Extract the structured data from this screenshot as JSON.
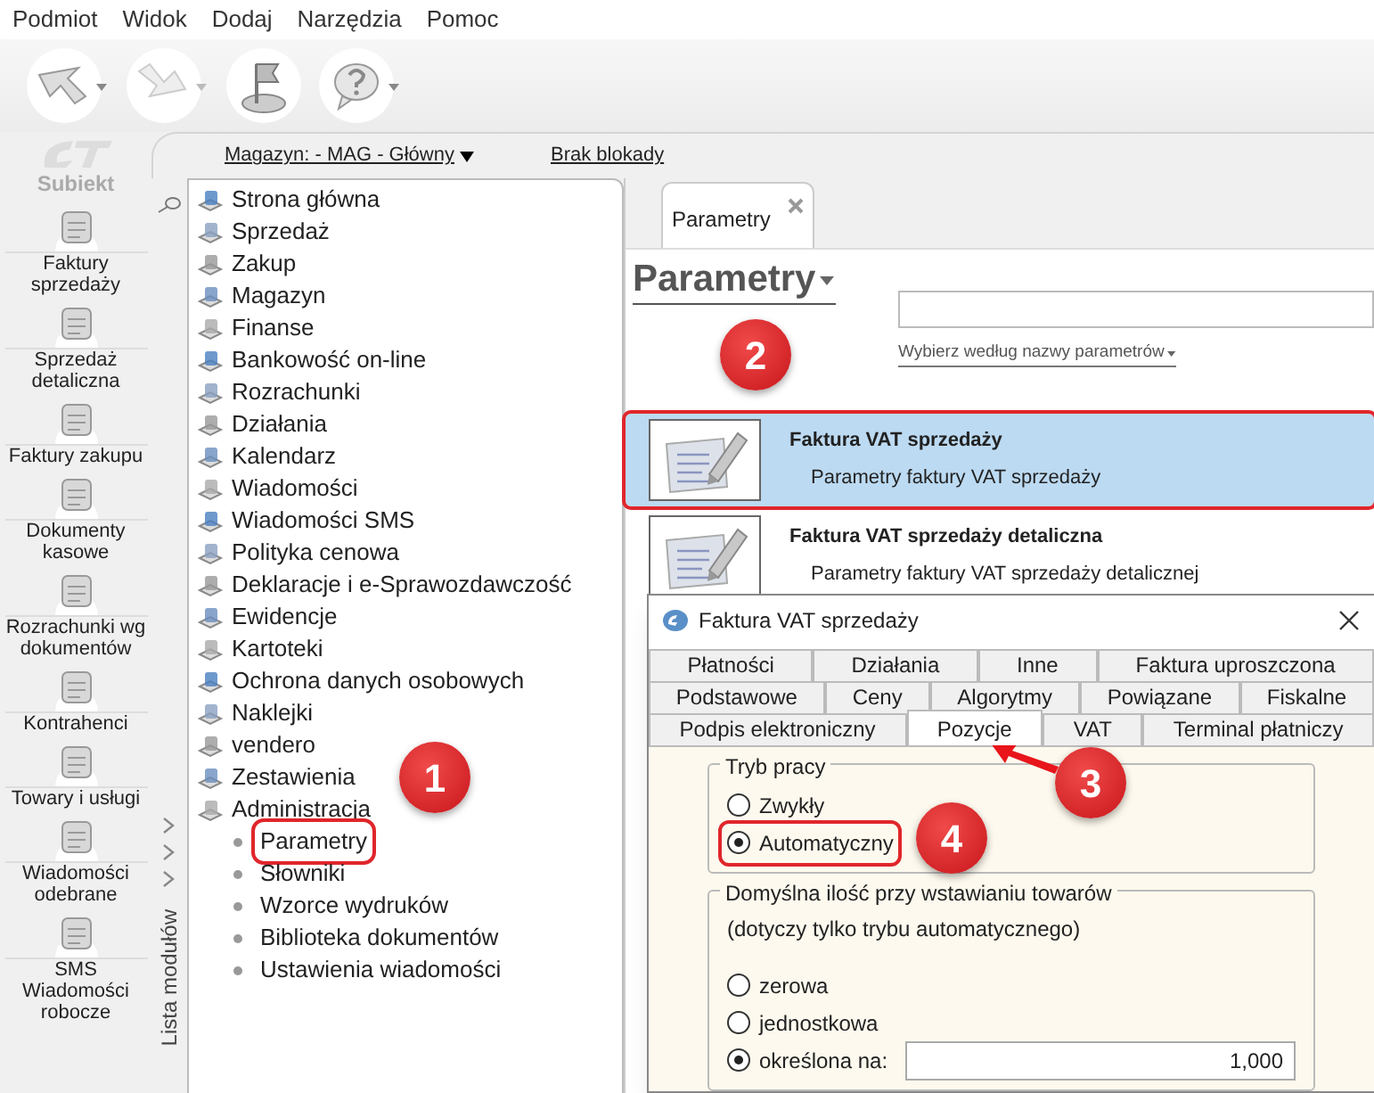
{
  "menu": [
    "Podmiot",
    "Widok",
    "Dodaj",
    "Narzędzia",
    "Pomoc"
  ],
  "sidebar": {
    "logo_text": "Subiekt",
    "items": [
      "Faktury sprzedaży",
      "Sprzedaż detaliczna",
      "Faktury zakupu",
      "Dokumenty kasowe",
      "Rozrachunki wg dokumentów",
      "Kontrahenci",
      "Towary i usługi",
      "Wiadomości odebrane",
      "SMS Wiadomości robocze"
    ]
  },
  "header": {
    "warehouse": "Magazyn: - MAG - Główny",
    "lock": "Brak blokady"
  },
  "modules": {
    "strip_label": "Lista modułów",
    "tree": [
      {
        "label": "Strona główna"
      },
      {
        "label": "Sprzedaż"
      },
      {
        "label": "Zakup"
      },
      {
        "label": "Magazyn"
      },
      {
        "label": "Finanse"
      },
      {
        "label": "Bankowość on-line"
      },
      {
        "label": "Rozrachunki"
      },
      {
        "label": "Działania"
      },
      {
        "label": "Kalendarz"
      },
      {
        "label": "Wiadomości"
      },
      {
        "label": "Wiadomości SMS"
      },
      {
        "label": "Polityka cenowa"
      },
      {
        "label": "Deklaracje i e-Sprawozdawczość"
      },
      {
        "label": "Ewidencje"
      },
      {
        "label": "Kartoteki"
      },
      {
        "label": "Ochrona danych osobowych"
      },
      {
        "label": "Naklejki"
      },
      {
        "label": "vendero"
      },
      {
        "label": "Zestawienia"
      },
      {
        "label": "Administracja",
        "children": [
          {
            "label": "Parametry",
            "highlighted": true
          },
          {
            "label": "Słowniki",
            "highlighted": false
          },
          {
            "label": "Wzorce wydruków",
            "highlighted": false
          },
          {
            "label": "Biblioteka dokumentów",
            "highlighted": false
          },
          {
            "label": "Ustawienia wiadomości",
            "highlighted": false
          }
        ]
      }
    ]
  },
  "doc_tabs": [
    {
      "label": "Parametry",
      "selected": true
    }
  ],
  "page_title": "Parametry",
  "filter_link": "Wybierz według nazwy parametrów",
  "results": [
    {
      "title": "Faktura VAT sprzedaży",
      "description": "Parametry faktury VAT sprzedaży",
      "selected": true,
      "highlighted": true
    },
    {
      "title": "Faktura VAT sprzedaży detaliczna",
      "description": "Parametry faktury VAT sprzedaży detalicznej",
      "selected": false,
      "highlighted": false
    }
  ],
  "dialog": {
    "title": "Faktura VAT sprzedaży",
    "tab_rows": [
      [
        {
          "label": "Płatności",
          "selected": false
        },
        {
          "label": "Działania",
          "selected": false
        },
        {
          "label": "Inne",
          "selected": false
        },
        {
          "label": "Faktura uproszczona",
          "selected": false
        }
      ],
      [
        {
          "label": "Podstawowe",
          "selected": false
        },
        {
          "label": "Ceny",
          "selected": false
        },
        {
          "label": "Algorytmy",
          "selected": false
        },
        {
          "label": "Powiązane",
          "selected": false
        },
        {
          "label": "Fiskalne",
          "selected": false
        }
      ],
      [
        {
          "label": "Podpis elektroniczny",
          "selected": false
        },
        {
          "label": "Pozycje",
          "selected": true
        },
        {
          "label": "VAT",
          "selected": false
        },
        {
          "label": "Terminal płatniczy",
          "selected": false
        }
      ]
    ],
    "mode": {
      "title": "Tryb pracy",
      "options": [
        {
          "label": "Zwykły",
          "selected": false,
          "highlighted": false
        },
        {
          "label": "Automatyczny",
          "selected": true,
          "highlighted": true
        }
      ]
    },
    "quantity": {
      "title": "Domyślna ilość przy wstawianiu towarów",
      "note": "(dotyczy tylko trybu automatycznego)",
      "options": [
        {
          "label": "zerowa",
          "selected": false
        },
        {
          "label": "jednostkowa",
          "selected": false
        },
        {
          "label": "określona na:",
          "selected": true,
          "value": "1,000"
        }
      ]
    }
  },
  "markers": [
    {
      "label": "1"
    },
    {
      "label": "2"
    },
    {
      "label": "3"
    },
    {
      "label": "4"
    }
  ]
}
